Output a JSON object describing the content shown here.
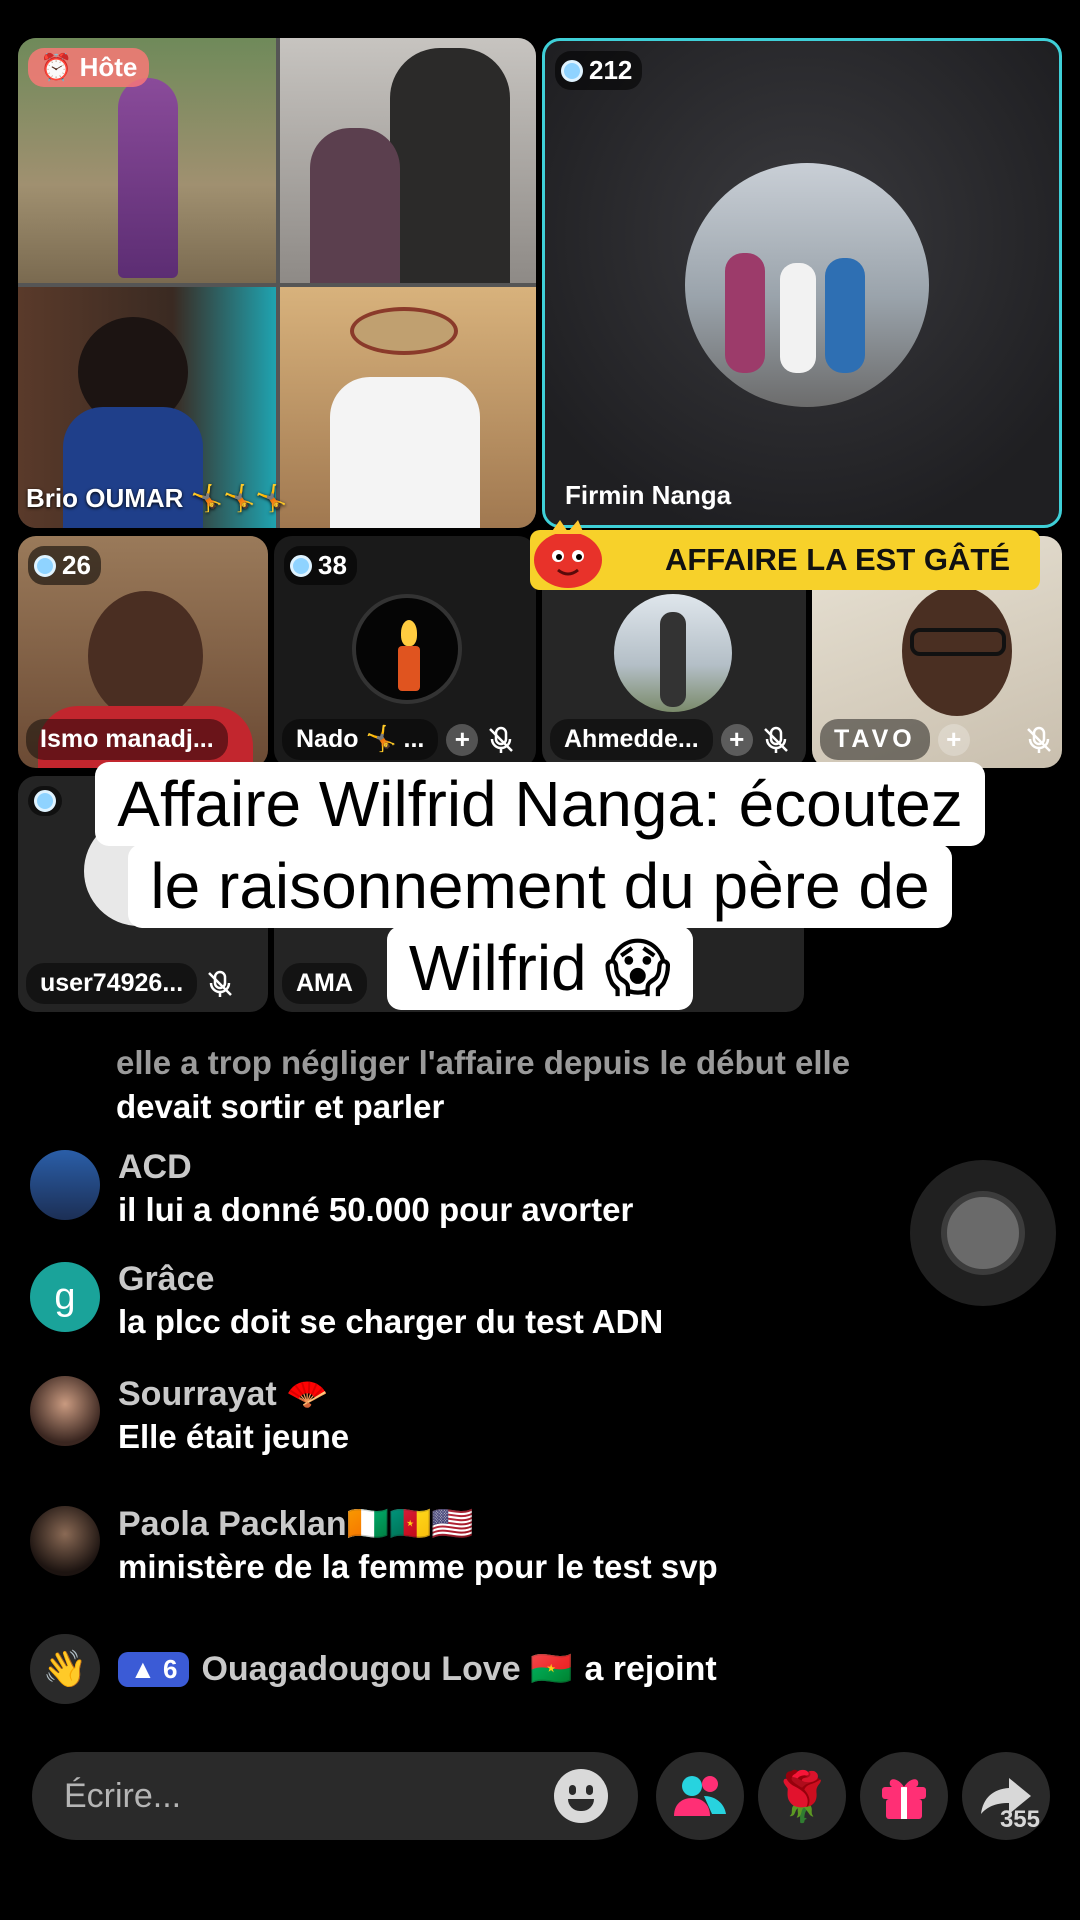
{
  "host_tile": {
    "badge": "Hôte",
    "name": "Brio OUMAR",
    "name_suffix": "🤸🤸🤸"
  },
  "feature_tile": {
    "count": "212",
    "name": "Firmin Nanga"
  },
  "row2": [
    {
      "count": "26",
      "name": "Ismo manadj..."
    },
    {
      "count": "38",
      "name": "Nado 🤸 ..."
    },
    {
      "count": "",
      "name": "Ahmedde..."
    },
    {
      "count": "",
      "name": "TAVO"
    }
  ],
  "row3": [
    {
      "name": "user74926..."
    },
    {
      "name": "AMA"
    }
  ],
  "banner": {
    "text": "AFFAIRE LA EST GÂTÉ"
  },
  "caption": {
    "line1": "Affaire Wilfrid Nanga: écoutez",
    "line2": "le raisonnement du père de",
    "line3": "Wilfrid 😱"
  },
  "comments": {
    "partial_line1": "elle a trop négliger l'affaire depuis le début elle",
    "partial_line2": "devait sortir et parler",
    "items": [
      {
        "name": "ACD",
        "text": "il lui a donné 50.000 pour avorter",
        "avatar": "photo"
      },
      {
        "name": "Grâce",
        "text": "la plcc doit se charger du test ADN",
        "avatar_letter": "g",
        "avatar_color": "#1aa39a"
      },
      {
        "name": "Sourrayat 🪭",
        "text": "Elle était jeune",
        "avatar": "photo"
      },
      {
        "name": "Paola Packlan🇨🇮🇨🇲🇺🇸",
        "text": "ministère de la femme pour le test svp",
        "avatar": "photo"
      }
    ],
    "join": {
      "level": "6",
      "name": "Ouagadougou Love 🇧🇫",
      "action": "a rejoint"
    }
  },
  "input": {
    "placeholder": "Écrire..."
  },
  "share_count": "355",
  "icons": [
    "hand-wave-icon",
    "emoji-icon",
    "people-icon",
    "rose-icon",
    "gift-icon",
    "share-icon",
    "mic-off-icon",
    "plus-icon"
  ]
}
